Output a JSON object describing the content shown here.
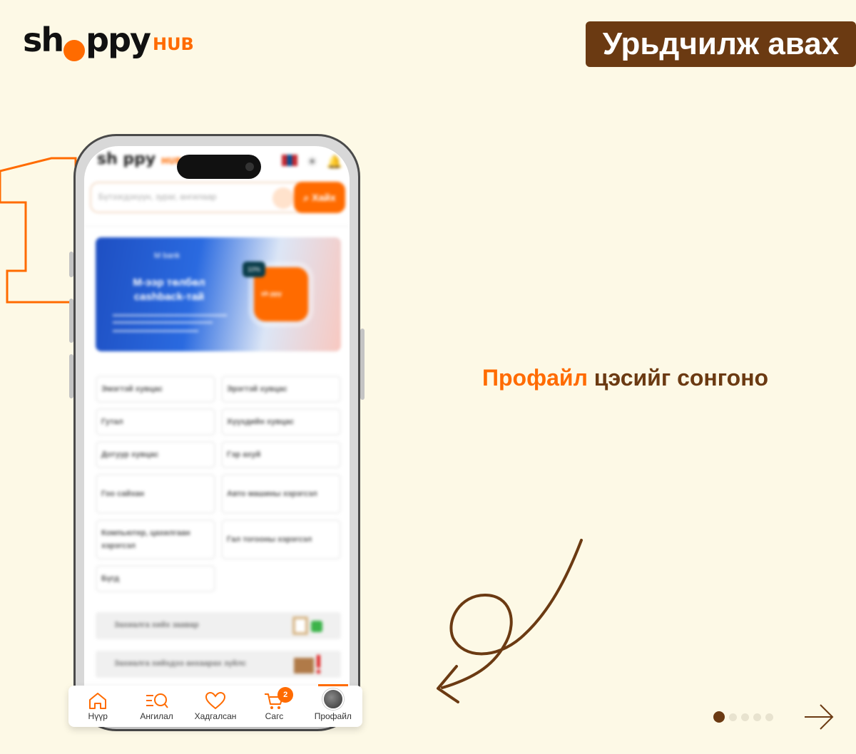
{
  "brand": {
    "logo_prefix": "sh",
    "logo_suffix": "ppy",
    "logo_sub": "HUB"
  },
  "tag": {
    "label": "Урьдчилж авах"
  },
  "step": {
    "number": "1"
  },
  "instruction": {
    "highlight": "Профайл",
    "rest": " цэсийг сонгоно"
  },
  "app": {
    "logo": "sh ppy",
    "logo_sub": "HUB",
    "search": {
      "placeholder": "Бүтээгдэхүүн, зураг, ангилаар",
      "button_label": "Хайх"
    },
    "banner": {
      "bank": "M bank",
      "title": "M-ээр төлбөл cashback-тай",
      "badge": "10%"
    },
    "categories": [
      "Эмэгтэй хувцас",
      "Эрэгтэй хувцас",
      "Гутал",
      "Хүүхдийн хувцас",
      "Дотуур хувцас",
      "Гэр ахуй",
      "Гоо сайхан",
      "Авто машины хэрэгсэл",
      "Компьютер, цахилгаан хэрэгсэл",
      "Гал тогооны хэрэгсэл",
      "Бүгд"
    ],
    "info_rows": [
      "Захиалга хийх заавар",
      "Захиалга хийхдээ анхаарах зүйлс"
    ],
    "nav": [
      {
        "label": "Нүүр",
        "icon": "home-icon"
      },
      {
        "label": "Ангилал",
        "icon": "category-search-icon"
      },
      {
        "label": "Хадгалсан",
        "icon": "heart-icon"
      },
      {
        "label": "Сагс",
        "icon": "cart-icon",
        "badge": "2"
      },
      {
        "label": "Профайл",
        "icon": "avatar"
      }
    ]
  },
  "pagination": {
    "total": 5,
    "active": 1
  },
  "colors": {
    "accent": "#FF6B00",
    "brown": "#6B3A12",
    "background": "#FDF9E6"
  }
}
